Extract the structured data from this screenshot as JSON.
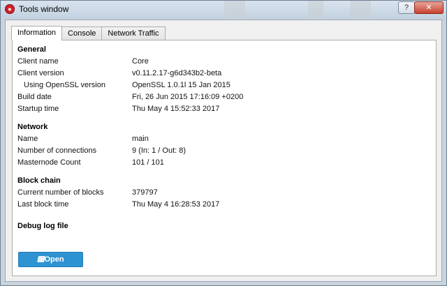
{
  "window": {
    "title": "Tools window"
  },
  "tabs": [
    {
      "label": "Information",
      "active": true
    },
    {
      "label": "Console",
      "active": false
    },
    {
      "label": "Network Traffic",
      "active": false
    }
  ],
  "general": {
    "heading": "General",
    "rows": [
      {
        "label": "Client name",
        "value": "Core"
      },
      {
        "label": "Client version",
        "value": "v0.11.2.17-g6d343b2-beta"
      },
      {
        "label": "Using OpenSSL version",
        "value": "OpenSSL 1.0.1l 15 Jan 2015"
      },
      {
        "label": "Build date",
        "value": "Fri, 26 Jun 2015 17:16:09 +0200"
      },
      {
        "label": "Startup time",
        "value": "Thu May 4 15:52:33 2017"
      }
    ]
  },
  "network": {
    "heading": "Network",
    "rows": [
      {
        "label": "Name",
        "value": "main"
      },
      {
        "label": "Number of connections",
        "value": "9 (In: 1 / Out: 8)"
      },
      {
        "label": "Masternode Count",
        "value": "101 / 101"
      }
    ]
  },
  "blockchain": {
    "heading": "Block chain",
    "rows": [
      {
        "label": "Current number of blocks",
        "value": "379797"
      },
      {
        "label": "Last block time",
        "value": "Thu May 4 16:28:53 2017"
      }
    ]
  },
  "debug": {
    "heading": "Debug log file",
    "open_label": "Open"
  },
  "colors": {
    "accent": "#2d93d1",
    "app_icon": "#d0202a"
  },
  "icons": {
    "app": "app-logo-icon",
    "open": "folder-icon",
    "close": "close-icon",
    "help": "help-icon"
  }
}
